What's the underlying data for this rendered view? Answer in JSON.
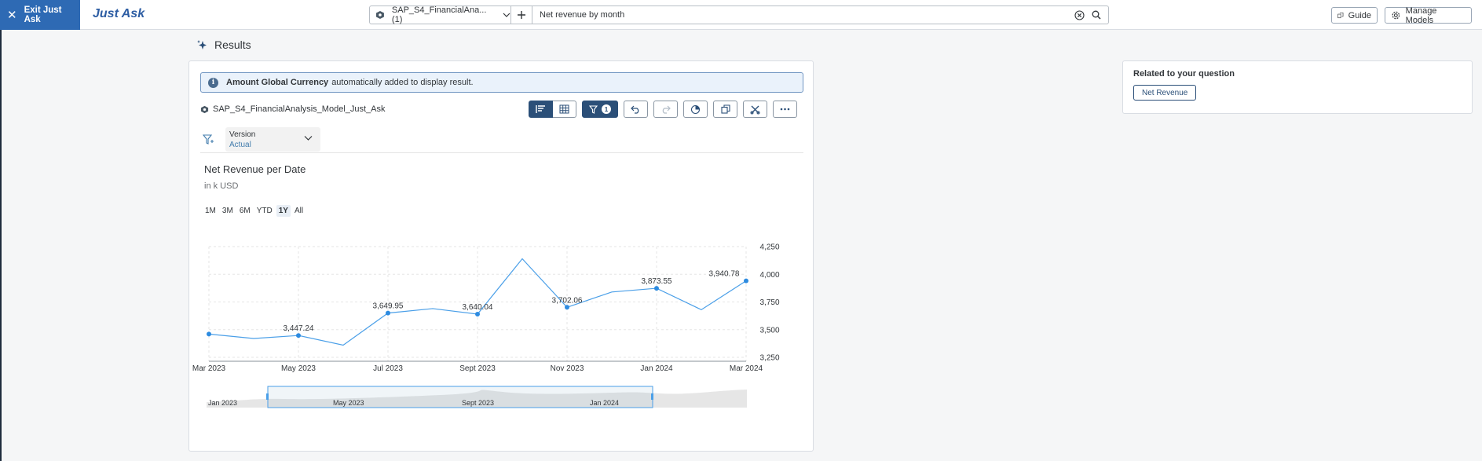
{
  "topbar": {
    "exit_label": "Exit Just Ask",
    "app_title": "Just Ask",
    "model_picker": "SAP_S4_FinancialAna... (1)",
    "search_value": "Net revenue by month",
    "guide_label": "Guide",
    "manage_models_label": "Manage Models"
  },
  "results": {
    "heading": "Results",
    "banner_bold": "Amount Global Currency",
    "banner_text": "automatically added to display result.",
    "model_name": "SAP_S4_FinancialAnalysis_Model_Just_Ask",
    "filter_count": "1",
    "version_label": "Version",
    "version_value": "Actual",
    "range_buttons": [
      "1M",
      "3M",
      "6M",
      "YTD",
      "1Y",
      "All"
    ],
    "range_selected": "1Y"
  },
  "chart_data": {
    "type": "line",
    "title": "Net Revenue per Date",
    "subtitle": "in k USD",
    "x": [
      "Mar 2023",
      "Apr 2023",
      "May 2023",
      "Jun 2023",
      "Jul 2023",
      "Aug 2023",
      "Sept 2023",
      "Oct 2023",
      "Nov 2023",
      "Dec 2023",
      "Jan 2024",
      "Feb 2024",
      "Mar 2024"
    ],
    "values": [
      3460,
      3420,
      3447.24,
      3360,
      3649.95,
      3690,
      3640.04,
      4140,
      3702.06,
      3840,
      3873.55,
      3680,
      3940.78
    ],
    "labeled_points": [
      {
        "x": "May 2023",
        "label": "3,447.24"
      },
      {
        "x": "Jul 2023",
        "label": "3,649.95"
      },
      {
        "x": "Sept 2023",
        "label": "3,640.04"
      },
      {
        "x": "Nov 2023",
        "label": "3,702.06"
      },
      {
        "x": "Jan 2024",
        "label": "3,873.55"
      },
      {
        "x": "Mar 2024",
        "label": "3,940.78"
      }
    ],
    "marked_points": [
      "Mar 2023",
      "May 2023",
      "Jul 2023",
      "Sept 2023",
      "Nov 2023",
      "Jan 2024",
      "Mar 2024"
    ],
    "x_tick_labels": [
      "Mar 2023",
      "May 2023",
      "Jul 2023",
      "Sept 2023",
      "Nov 2023",
      "Jan 2024",
      "Mar 2024"
    ],
    "y_ticks": [
      3250,
      3500,
      3750,
      4000,
      4250
    ],
    "y_tick_labels": [
      "3,250",
      "3,500",
      "3,750",
      "4,000",
      "4,250"
    ],
    "ylim": [
      3250,
      4250
    ],
    "y_axis_side": "right",
    "grid": true,
    "line_color": "#4a9fe8",
    "navigator_labels": [
      "Jan 2023",
      "May 2023",
      "Sept 2023",
      "Jan 2024"
    ]
  },
  "related": {
    "title": "Related to your question",
    "chip": "Net Revenue"
  },
  "colors": {
    "brand": "#2e6ab4",
    "accent_dark": "#2b4f78",
    "line": "#4a9fe8"
  }
}
